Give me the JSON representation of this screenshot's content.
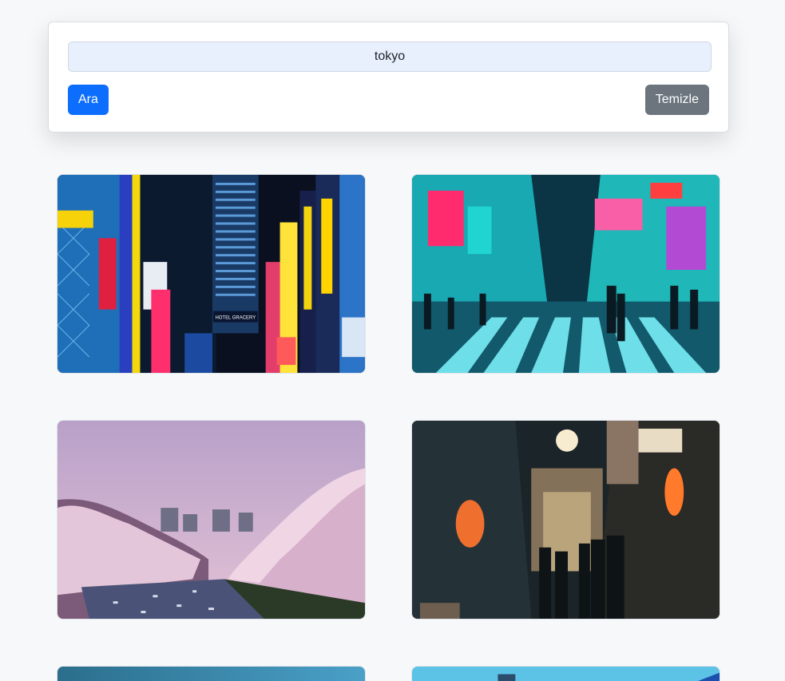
{
  "search": {
    "value": "tokyo",
    "search_button": "Ara",
    "clear_button": "Temizle"
  },
  "colors": {
    "primary": "#0d6efd",
    "secondary": "#6c757d",
    "input_bg": "#e8f0fe",
    "page_bg": "#f7f8fa"
  },
  "photos": [
    {
      "subject": "Shinjuku neon signs at night",
      "sign_text": "HOTEL GRACERY"
    },
    {
      "subject": "Akihabara crosswalk at night"
    },
    {
      "subject": "Cherry blossoms along canal at dusk"
    },
    {
      "subject": "Omoide Yokocho lantern alley"
    },
    {
      "subject": "Blue sky cityscape (partially visible)"
    },
    {
      "subject": "Blue sky cityscape (partially visible)"
    }
  ]
}
